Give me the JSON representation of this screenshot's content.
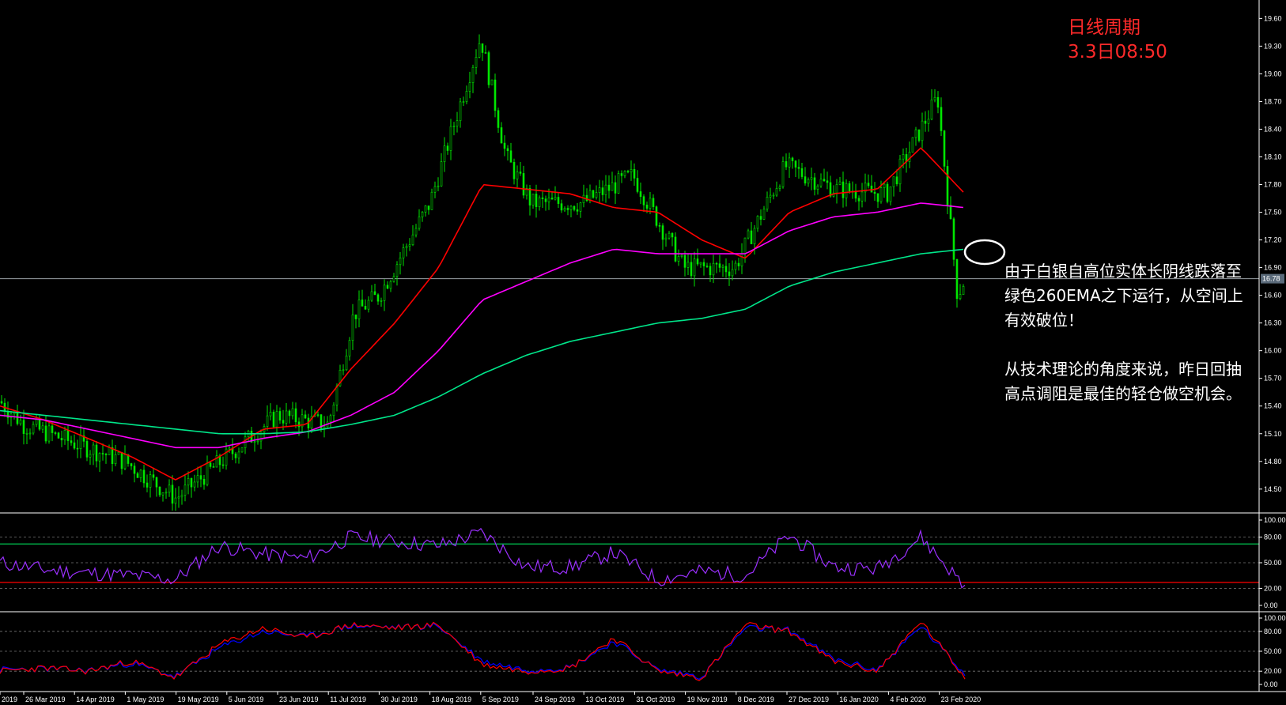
{
  "annotation": {
    "title": "日线周期",
    "time": "3.3日08:50",
    "para1": [
      "由于白银自高位实体长阴线跌落至",
      "绿色260EMA之下运行，从空间上",
      "有效破位！"
    ],
    "para2": [
      "从技术理论的角度来说，昨日回抽",
      "高点调阻是最佳的轻仓做空机会。"
    ]
  },
  "colors": {
    "background": "#000000",
    "candle": "#00e600",
    "ema_short": "#ff0000",
    "ema_mid": "#ff00ff",
    "ema_long": "#00e68a",
    "rsi": "#9b30ff",
    "stoch_main": "#ff0000",
    "stoch_signal": "#0000ff",
    "level_upper": "#00c853",
    "level_lower": "#ff0000",
    "current_price_line": "#9aa0a6"
  },
  "chart_data": [
    {
      "type": "candlestick",
      "symbol": "",
      "timeframe": "daily",
      "x_labels": [
        "2019",
        "26 Mar 2019",
        "14 Apr 2019",
        "1 May 2019",
        "19 May 2019",
        "5 Jun 2019",
        "23 Jun 2019",
        "11 Jul 2019",
        "30 Jul 2019",
        "18 Aug 2019",
        "5 Sep 2019",
        "24 Sep 2019",
        "13 Oct 2019",
        "31 Oct 2019",
        "19 Nov 2019",
        "8 Dec 2019",
        "27 Dec 2019",
        "16 Jan 2020",
        "4 Feb 2020",
        "23 Feb 2020"
      ],
      "y_ticks": [
        "19.60",
        "19.30",
        "19.00",
        "18.70",
        "18.40",
        "18.10",
        "17.80",
        "17.50",
        "17.20",
        "16.90",
        "16.60",
        "16.30",
        "16.00",
        "15.70",
        "15.40",
        "15.10",
        "14.80",
        "14.50"
      ],
      "ylim": [
        14.25,
        19.8
      ],
      "current_price": "16.78",
      "close_path": [
        {
          "x": "Mar 2019",
          "y": 15.45
        },
        {
          "x": "26 Mar 2019",
          "y": 15.2
        },
        {
          "x": "14 Apr 2019",
          "y": 15.0
        },
        {
          "x": "1 May 2019",
          "y": 14.8
        },
        {
          "x": "19 May 2019",
          "y": 14.4
        },
        {
          "x": "5 Jun 2019",
          "y": 14.85
        },
        {
          "x": "23 Jun 2019",
          "y": 15.3
        },
        {
          "x": "11 Jul 2019",
          "y": 15.2
        },
        {
          "x": "20 Jul 2019",
          "y": 16.4
        },
        {
          "x": "30 Jul 2019",
          "y": 16.6
        },
        {
          "x": "18 Aug 2019",
          "y": 17.6
        },
        {
          "x": "5 Sep 2019",
          "y": 19.4
        },
        {
          "x": "9 Sep 2019",
          "y": 18.1
        },
        {
          "x": "24 Sep 2019",
          "y": 17.6
        },
        {
          "x": "13 Oct 2019",
          "y": 17.6
        },
        {
          "x": "31 Oct 2019",
          "y": 17.9
        },
        {
          "x": "19 Nov 2019",
          "y": 16.9
        },
        {
          "x": "8 Dec 2019",
          "y": 16.9
        },
        {
          "x": "27 Dec 2019",
          "y": 18.0
        },
        {
          "x": "16 Jan 2020",
          "y": 17.75
        },
        {
          "x": "4 Feb 2020",
          "y": 17.7
        },
        {
          "x": "23 Feb 2020",
          "y": 18.75
        },
        {
          "x": "28 Feb 2020",
          "y": 16.6
        },
        {
          "x": "3 Mar 2020",
          "y": 16.78
        }
      ],
      "circle_note": "ellipse around break of green EMA near 23 Feb 2020",
      "series": [
        {
          "name": "",
          "style": "ema_short",
          "values": [
            15.4,
            15.25,
            15.05,
            14.85,
            14.6,
            14.85,
            15.15,
            15.2,
            15.8,
            16.3,
            16.9,
            17.8,
            17.75,
            17.7,
            17.55,
            17.5,
            17.2,
            17.0,
            17.5,
            17.7,
            17.75,
            18.2,
            17.7
          ]
        },
        {
          "name": "",
          "style": "ema_mid",
          "values": [
            15.3,
            15.25,
            15.15,
            15.05,
            14.95,
            14.95,
            15.05,
            15.12,
            15.3,
            15.55,
            16.0,
            16.55,
            16.75,
            16.95,
            17.1,
            17.05,
            17.05,
            17.05,
            17.3,
            17.45,
            17.5,
            17.6,
            17.55
          ]
        },
        {
          "name": "EMA 260",
          "style": "ema_long",
          "values": [
            15.35,
            15.3,
            15.25,
            15.2,
            15.15,
            15.1,
            15.1,
            15.12,
            15.2,
            15.3,
            15.5,
            15.75,
            15.95,
            16.1,
            16.2,
            16.3,
            16.35,
            16.45,
            16.7,
            16.85,
            16.95,
            17.05,
            17.1
          ]
        }
      ]
    },
    {
      "type": "line",
      "title": "",
      "y_ticks": [
        "100.00",
        "80.00",
        "50.00",
        "20.00",
        "0.00"
      ],
      "ylim": [
        0,
        100
      ],
      "levels": [
        72,
        27
      ],
      "series": [
        {
          "name": "",
          "values": [
            50,
            42,
            38,
            35,
            30,
            70,
            60,
            55,
            80,
            75,
            70,
            85,
            45,
            45,
            62,
            30,
            40,
            35,
            82,
            45,
            43,
            80,
            22
          ]
        }
      ]
    },
    {
      "type": "line",
      "title": "",
      "y_ticks": [
        "100.00",
        "80.00",
        "50.00",
        "20.00",
        "0.00"
      ],
      "ylim": [
        0,
        100
      ],
      "series": [
        {
          "name": "",
          "values": [
            20,
            25,
            20,
            35,
            10,
            60,
            85,
            70,
            90,
            85,
            90,
            30,
            20,
            25,
            70,
            20,
            10,
            90,
            80,
            35,
            20,
            95,
            10
          ]
        },
        {
          "name": "",
          "values": [
            22,
            24,
            21,
            32,
            12,
            55,
            80,
            72,
            88,
            86,
            88,
            35,
            22,
            26,
            65,
            22,
            12,
            85,
            82,
            38,
            22,
            88,
            15
          ]
        }
      ]
    }
  ]
}
